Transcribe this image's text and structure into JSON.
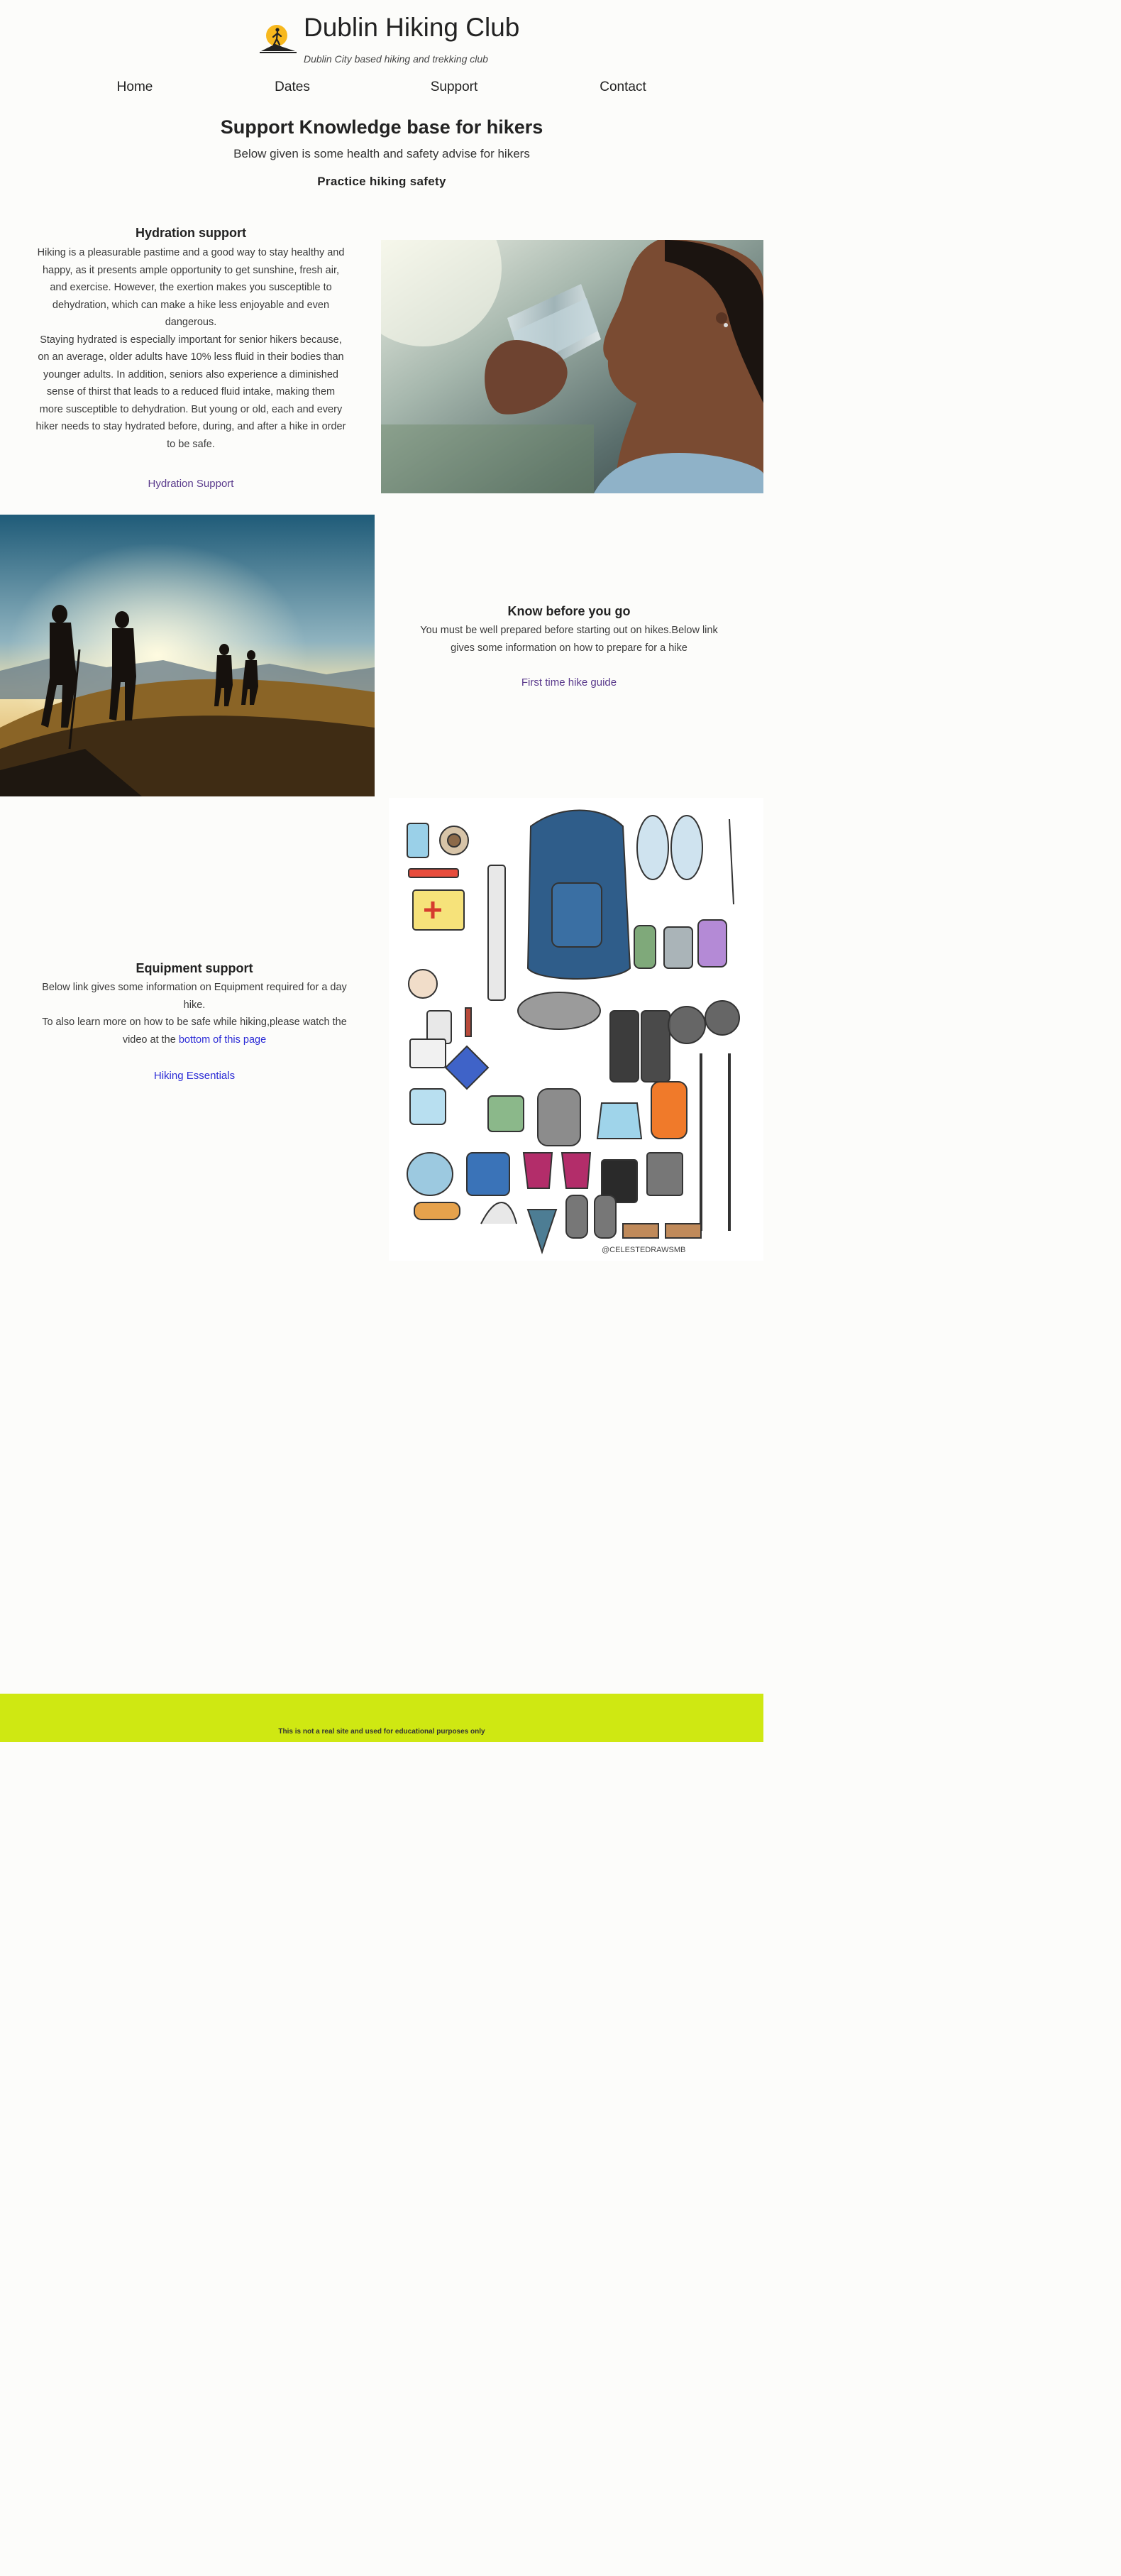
{
  "header": {
    "title": "Dublin Hiking Club",
    "tagline": "Dublin City based hiking and trekking club"
  },
  "nav": {
    "items": [
      {
        "label": "Home"
      },
      {
        "label": "Dates"
      },
      {
        "label": "Support"
      },
      {
        "label": "Contact"
      }
    ]
  },
  "main": {
    "heading": "Support Knowledge base for hikers",
    "subheading": "Below given is some health and safety advise for hikers",
    "section_title": "Practice hiking safety"
  },
  "hydration": {
    "title": "Hydration support",
    "lines": [
      "Hiking is a pleasurable pastime and a good way to stay healthy and",
      "happy, as it presents ample opportunity to get sunshine, fresh air,",
      "and exercise. However, the exertion makes you susceptible to",
      "dehydration, which can make a hike less enjoyable and even",
      "dangerous.",
      "Staying hydrated is especially important for senior hikers because,",
      "on an average, older adults have 10% less fluid in their bodies than",
      "younger adults. In addition, seniors also experience a diminished",
      "sense of thirst that leads to a reduced fluid intake, making them",
      "more susceptible to dehydration. But young or old, each and every",
      "hiker needs to stay hydrated before, during, and after a hike in order",
      "to be safe."
    ],
    "link": "Hydration Support"
  },
  "know_before": {
    "title": "Know before you go",
    "lines": [
      "You must be well prepared before starting out on hikes.Below link",
      "gives some information on how to prepare for a hike"
    ],
    "link": "First time hike guide"
  },
  "equipment": {
    "title": "Equipment support",
    "line1": "Below link gives some information on Equipment required for a day",
    "line2": "hike.",
    "line3": "To also learn more on how to be safe while hiking,please watch the",
    "line4_prefix": "video at the ",
    "line4_link": "bottom of this page",
    "link": "Hiking Essentials",
    "gear_credit": "@CELESTEDRAWSMB"
  },
  "footer": {
    "text": "This is not a real site and used for educational purposes only"
  },
  "colors": {
    "background": "#fcfcfa",
    "footer": "#cfe812",
    "visited_link": "#5a3a8c",
    "link": "#2b2bd6"
  }
}
